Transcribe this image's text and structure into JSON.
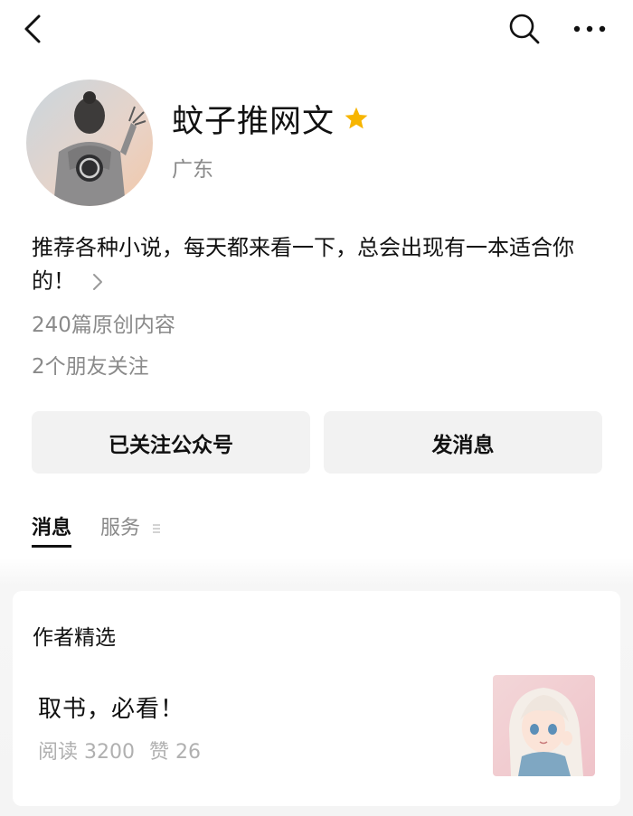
{
  "account": {
    "name": "蚊子推网文",
    "region": "广东",
    "bio": "推荐各种小说，每天都来看一下，总会出现有一本适合你的！",
    "original_count": "240篇原创内容",
    "friends_following": "2个朋友关注"
  },
  "actions": {
    "follow_label": "已关注公众号",
    "message_label": "发消息"
  },
  "tabs": [
    {
      "label": "消息",
      "active": true
    },
    {
      "label": "服务",
      "active": false
    }
  ],
  "featured": {
    "section_title": "作者精选",
    "articles": [
      {
        "title": "取书，必看！",
        "reads": "阅读 3200",
        "likes": "赞 26"
      }
    ]
  },
  "icons": {
    "back": "chevron-left-icon",
    "search": "search-icon",
    "more": "more-dots-icon",
    "verified": "star-icon",
    "bio_expand": "chevron-right-icon"
  },
  "colors": {
    "star": "#F7B500",
    "secondary_text": "#8A8A8A",
    "button_bg": "#F2F2F2"
  }
}
